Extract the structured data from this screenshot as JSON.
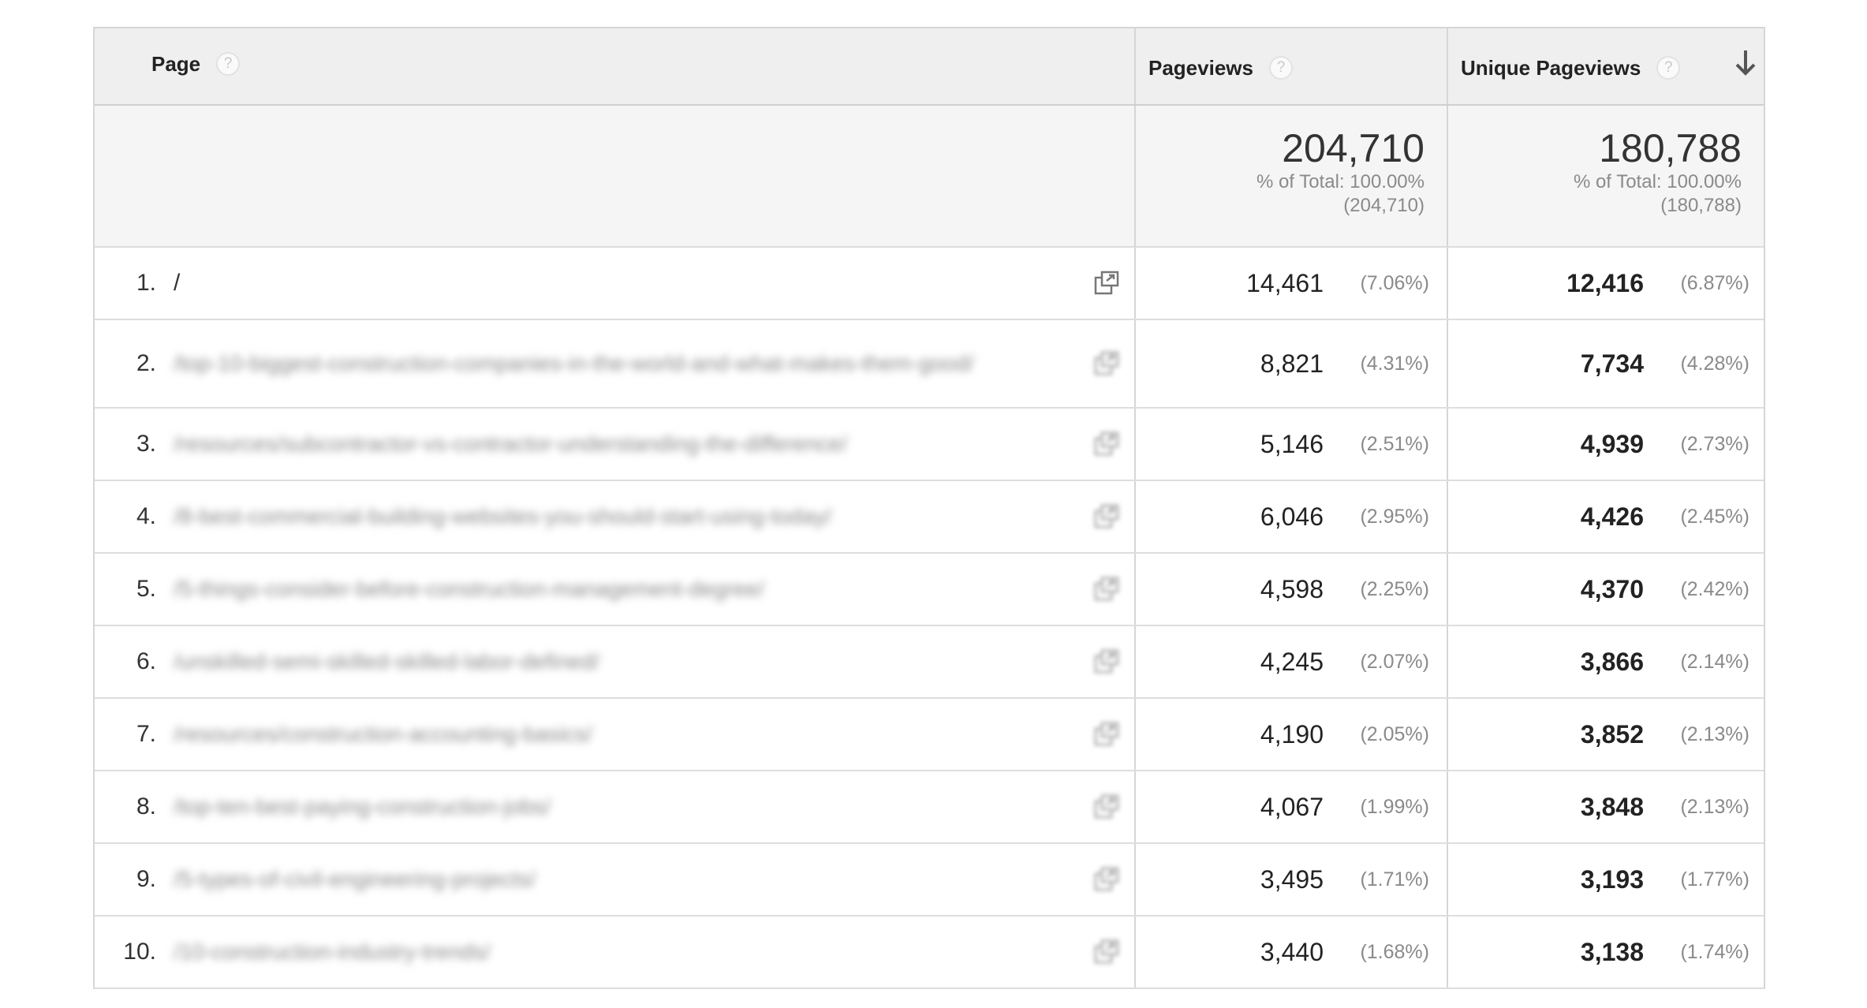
{
  "table": {
    "columns": {
      "page": "Page",
      "pageviews": "Pageviews",
      "unique_pageviews": "Unique Pageviews",
      "help": "?"
    },
    "totals": {
      "pageviews": {
        "value": "204,710",
        "pct_line": "% of Total: 100.00%",
        "of_line": "(204,710)"
      },
      "unique_pageviews": {
        "value": "180,788",
        "pct_line": "% of Total: 100.00%",
        "of_line": "(180,788)"
      }
    },
    "rows": [
      {
        "rank": "1.",
        "page": "/",
        "blurred": false,
        "pageviews": "14,461",
        "pageviews_pct": "(7.06%)",
        "unique": "12,416",
        "unique_pct": "(6.87%)"
      },
      {
        "rank": "2.",
        "page": "/top-10-biggest-construction-companies-in-the-world-and-what-makes-them-good/",
        "blurred": true,
        "pageviews": "8,821",
        "pageviews_pct": "(4.31%)",
        "unique": "7,734",
        "unique_pct": "(4.28%)"
      },
      {
        "rank": "3.",
        "page": "/resources/subcontractor-vs-contractor-understanding-the-difference/",
        "blurred": true,
        "pageviews": "5,146",
        "pageviews_pct": "(2.51%)",
        "unique": "4,939",
        "unique_pct": "(2.73%)"
      },
      {
        "rank": "4.",
        "page": "/8-best-commercial-building-websites-you-should-start-using-today/",
        "blurred": true,
        "pageviews": "6,046",
        "pageviews_pct": "(2.95%)",
        "unique": "4,426",
        "unique_pct": "(2.45%)"
      },
      {
        "rank": "5.",
        "page": "/5-things-consider-before-construction-management-degree/",
        "blurred": true,
        "pageviews": "4,598",
        "pageviews_pct": "(2.25%)",
        "unique": "4,370",
        "unique_pct": "(2.42%)"
      },
      {
        "rank": "6.",
        "page": "/unskilled-semi-skilled-skilled-labor-defined/",
        "blurred": true,
        "pageviews": "4,245",
        "pageviews_pct": "(2.07%)",
        "unique": "3,866",
        "unique_pct": "(2.14%)"
      },
      {
        "rank": "7.",
        "page": "/resources/construction-accounting-basics/",
        "blurred": true,
        "pageviews": "4,190",
        "pageviews_pct": "(2.05%)",
        "unique": "3,852",
        "unique_pct": "(2.13%)"
      },
      {
        "rank": "8.",
        "page": "/top-ten-best-paying-construction-jobs/",
        "blurred": true,
        "pageviews": "4,067",
        "pageviews_pct": "(1.99%)",
        "unique": "3,848",
        "unique_pct": "(2.13%)"
      },
      {
        "rank": "9.",
        "page": "/5-types-of-civil-engineering-projects/",
        "blurred": true,
        "pageviews": "3,495",
        "pageviews_pct": "(1.71%)",
        "unique": "3,193",
        "unique_pct": "(1.77%)"
      },
      {
        "rank": "10.",
        "page": "/10-construction-industry-trends/",
        "blurred": true,
        "pageviews": "3,440",
        "pageviews_pct": "(1.68%)",
        "unique": "3,138",
        "unique_pct": "(1.74%)"
      }
    ]
  },
  "icons": {
    "help": "help-circle-icon",
    "sort": "arrow-down-icon",
    "open_page": "open-external-icon"
  }
}
